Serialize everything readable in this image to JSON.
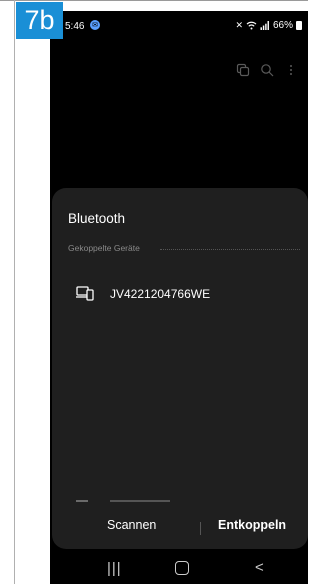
{
  "step_badge": "7b",
  "status_bar": {
    "time": "5:46",
    "battery": "66%"
  },
  "top_actions": [
    "layers-icon",
    "search-icon",
    "more-vert-icon"
  ],
  "sheet": {
    "title": "Bluetooth",
    "section_label": "Gekoppelte Geräte",
    "devices": [
      {
        "name": "JV4221204766WE",
        "icon": "laptop-phone-icon"
      }
    ],
    "scan_label": "Scannen",
    "disconnect_label": "Entkoppeln"
  },
  "nav_bar": {
    "recent_glyph": "|||",
    "back_glyph": "<"
  },
  "colors": {
    "badge": "#1a8fd6",
    "sheet_bg": "#1f1f1f",
    "screen_bg": "#000000"
  }
}
